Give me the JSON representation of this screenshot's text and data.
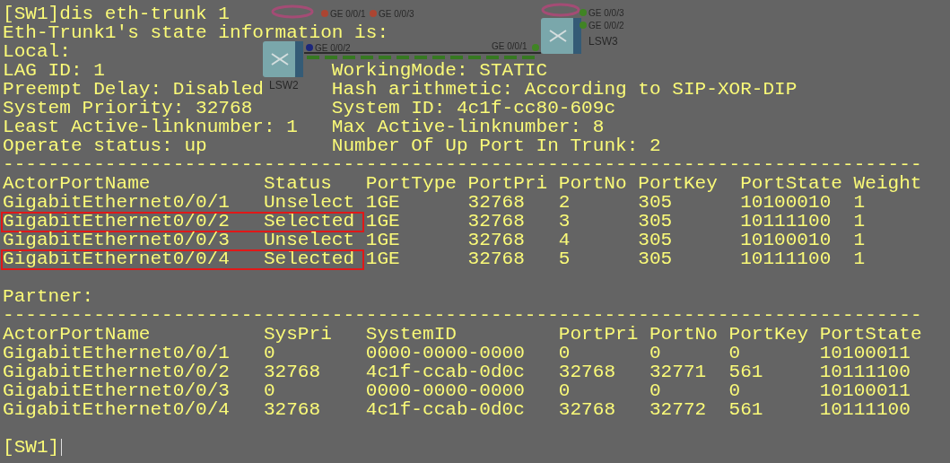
{
  "topology": {
    "switches": [
      {
        "name": "LSW2"
      },
      {
        "name": "LSW3"
      }
    ],
    "ports": [
      {
        "label": "GE 0/0/1",
        "color": "#b8402a"
      },
      {
        "label": "GE 0/0/3",
        "color": "#b8402a"
      },
      {
        "label": "GE 0/0/2",
        "color": "#101c80"
      },
      {
        "label": "GE 0/0/1",
        "color": "#3a8a1a"
      },
      {
        "label": "GE 0/0/3",
        "color": "#3a8a1a"
      },
      {
        "label": "GE 0/0/2",
        "color": "#3a8a1a"
      }
    ]
  },
  "terminal": {
    "command": "[SW1]dis eth-trunk 1",
    "heading": "Eth-Trunk1's state information is:",
    "local_label": "Local:",
    "local_info": [
      {
        "left": "LAG ID: 1",
        "right": "WorkingMode: STATIC"
      },
      {
        "left": "Preempt Delay: Disabled",
        "right": "Hash arithmetic: According to SIP-XOR-DIP"
      },
      {
        "left": "System Priority: 32768",
        "right": "System ID: 4c1f-cc80-609c"
      },
      {
        "left": "Least Active-linknumber: 1",
        "right": "Max Active-linknumber: 8"
      },
      {
        "left": "Operate status: up",
        "right": "Number Of Up Port In Trunk: 2"
      }
    ],
    "separator_1": "---------------------------------------------------------------------------------",
    "actor_table": {
      "columns": [
        "ActorPortName",
        "Status",
        "PortType",
        "PortPri",
        "PortNo",
        "PortKey",
        "PortState",
        "Weight"
      ],
      "rows": [
        {
          "cells": [
            "GigabitEthernet0/0/1",
            "Unselect",
            "1GE",
            "32768",
            "2",
            "305",
            "10100010",
            "1"
          ],
          "highlighted": false
        },
        {
          "cells": [
            "GigabitEthernet0/0/2",
            "Selected",
            "1GE",
            "32768",
            "3",
            "305",
            "10111100",
            "1"
          ],
          "highlighted": true
        },
        {
          "cells": [
            "GigabitEthernet0/0/3",
            "Unselect",
            "1GE",
            "32768",
            "4",
            "305",
            "10100010",
            "1"
          ],
          "highlighted": false
        },
        {
          "cells": [
            "GigabitEthernet0/0/4",
            "Selected",
            "1GE",
            "32768",
            "5",
            "305",
            "10111100",
            "1"
          ],
          "highlighted": true
        }
      ]
    },
    "partner_label": "Partner:",
    "separator_2": "---------------------------------------------------------------------------------",
    "partner_table": {
      "columns": [
        "ActorPortName",
        "SysPri",
        "SystemID",
        "PortPri",
        "PortNo",
        "PortKey",
        "PortState"
      ],
      "rows": [
        {
          "cells": [
            "GigabitEthernet0/0/1",
            "0",
            "0000-0000-0000",
            "0",
            "0",
            "0",
            "10100011"
          ]
        },
        {
          "cells": [
            "GigabitEthernet0/0/2",
            "32768",
            "4c1f-ccab-0d0c",
            "32768",
            "32771",
            "561",
            "10111100"
          ]
        },
        {
          "cells": [
            "GigabitEthernet0/0/3",
            "0",
            "0000-0000-0000",
            "0",
            "0",
            "0",
            "10100011"
          ]
        },
        {
          "cells": [
            "GigabitEthernet0/0/4",
            "32768",
            "4c1f-ccab-0d0c",
            "32768",
            "32772",
            "561",
            "10111100"
          ]
        }
      ]
    },
    "prompt": "[SW1]"
  }
}
